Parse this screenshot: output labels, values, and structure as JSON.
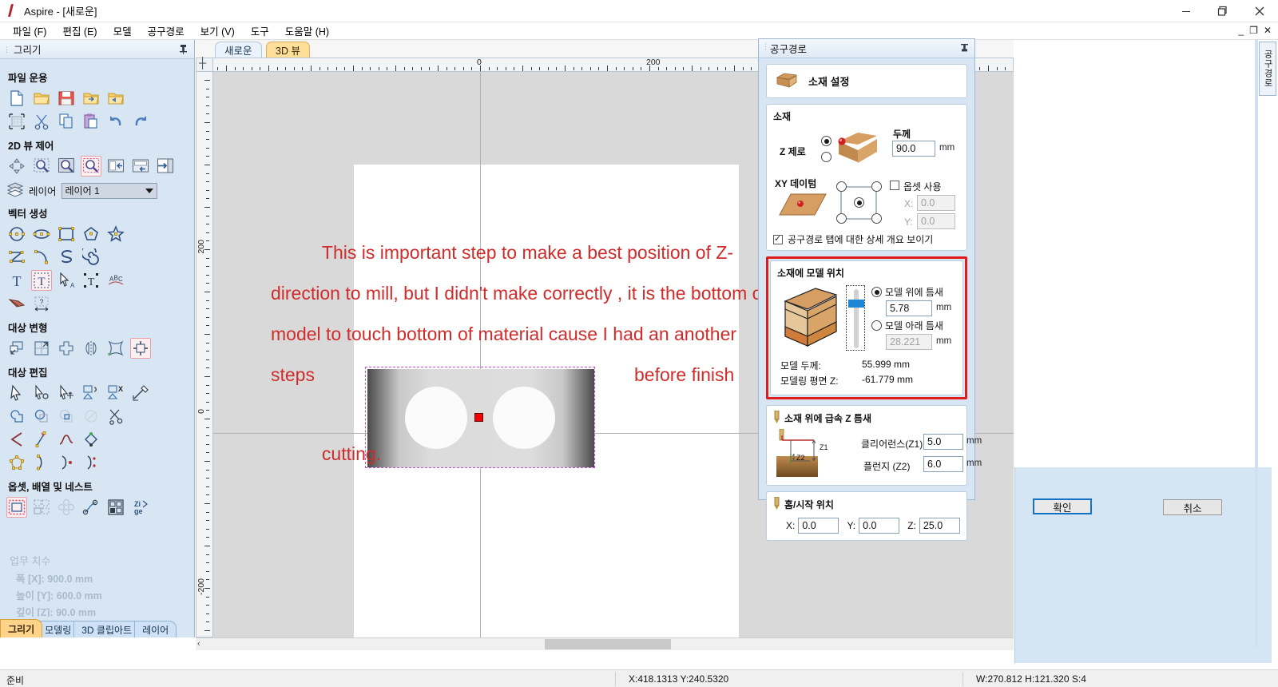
{
  "window": {
    "title": "Aspire - [새로운]",
    "logo_icon": "aspire-logo-icon",
    "minimize": "–",
    "maximize": "❐",
    "close": "✕",
    "mdi_minimize": "_",
    "mdi_restore": "❐",
    "mdi_close": "✕"
  },
  "menubar": {
    "items": [
      {
        "label": "파일 (F)"
      },
      {
        "label": "편집 (E)"
      },
      {
        "label": "모델"
      },
      {
        "label": "공구경로"
      },
      {
        "label": "보기 (V)"
      },
      {
        "label": "도구"
      },
      {
        "label": "도움말 (H)"
      }
    ]
  },
  "left_panel": {
    "title": "그리기",
    "pin_icon": "pin-icon",
    "groups": [
      {
        "title": "파일 운용"
      },
      {
        "title": "2D 뷰 제어"
      },
      {
        "title": "벡터 생성"
      },
      {
        "title": "대상 변형"
      },
      {
        "title": "대상 편집"
      },
      {
        "title": "옵셋, 배열 및 네스트"
      }
    ],
    "layer": {
      "label": "레이어",
      "selected": "레이어 1"
    },
    "job_size": {
      "title": "업무 치수",
      "width": "폭  [X]: 900.0 mm",
      "height": "높이 [Y]: 600.0 mm",
      "depth": "깊이 [Z]: 90.0 mm"
    },
    "tabs": [
      {
        "label": "그리기",
        "active": true
      },
      {
        "label": "모델링",
        "active": false
      },
      {
        "label": "3D 클립아트",
        "active": false
      },
      {
        "label": "레이어",
        "active": false
      }
    ]
  },
  "center": {
    "tabs": [
      {
        "label": "새로운",
        "active": true
      },
      {
        "label": "3D 뷰",
        "active": false
      }
    ],
    "ruler": {
      "h_labels": [
        "0",
        "200"
      ],
      "v_labels": [
        "200",
        "0",
        "-200"
      ]
    },
    "annotation": "This is important step to make a best position of Z-direction to mill, but I didn't make correctly , it is the bottom of model to touch bottom of material cause I had an another steps",
    "annotation_tail": "before finish",
    "annotation_tail2": "cutting.",
    "annotation_color": "#cf2c2c"
  },
  "toolpath_panel": {
    "title": "공구경로",
    "pin_icon": "pin-icon",
    "material_setup": {
      "icon": "material-block-icon",
      "label": "소재 설정"
    },
    "material": {
      "section_title": "소재",
      "z_zero_label": "Z 제로",
      "z_zero_top_selected": true,
      "z_zero_bottom_selected": false,
      "thickness_label": "두께",
      "thickness_value": "90.0",
      "thickness_unit": "mm",
      "xy_datum_label": "XY 데이텀",
      "datum_selected": "center",
      "use_offset_label": "옵셋 사용",
      "use_offset_checked": false,
      "offset_x_label": "X:",
      "offset_x_value": "0.0",
      "offset_y_label": "Y:",
      "offset_y_value": "0.0",
      "show_summary_label": "공구경로 탭에 대한 상세 개요 보이기",
      "show_summary_checked": true
    },
    "model_position": {
      "section_title": "소재에 모델 위치",
      "highlight_color": "#e01b1b",
      "gap_above_label": "모델 위에 틈새",
      "gap_above_selected": true,
      "gap_above_value": "5.78",
      "gap_above_unit": "mm",
      "gap_below_label": "모델 아래 틈새",
      "gap_below_selected": false,
      "gap_below_value": "28.221",
      "gap_below_unit": "mm",
      "model_thickness_label": "모델 두께:",
      "model_thickness_value": "55.999 mm",
      "modeling_plane_label": "모델링 평면 Z:",
      "modeling_plane_value": "-61.779 mm"
    },
    "rapid_z": {
      "section_title": "소재 위에 급속 Z 틈새",
      "clearance_label": "클리어런스(Z1)",
      "clearance_tag": "Z1",
      "clearance_value": "5.0",
      "clearance_unit": "mm",
      "plunge_label": "플런지 (Z2)",
      "plunge_tag": "Z2",
      "plunge_value": "6.0",
      "plunge_unit": "mm"
    },
    "home_position": {
      "section_title": "홈/시작 위치",
      "x_label": "X:",
      "x_value": "0.0",
      "y_label": "Y:",
      "y_value": "0.0",
      "z_label": "Z:",
      "z_value": "25.0"
    }
  },
  "dialog": {
    "ok_label": "확인",
    "cancel_label": "취소",
    "ok_focus_color": "#1273c4"
  },
  "right_vertical_tab": {
    "label": "공구경로"
  },
  "statusbar": {
    "ready": "준비",
    "coords": "X:418.1313 Y:240.5320",
    "dimensions": "W:270.812  H:121.320  S:4"
  }
}
